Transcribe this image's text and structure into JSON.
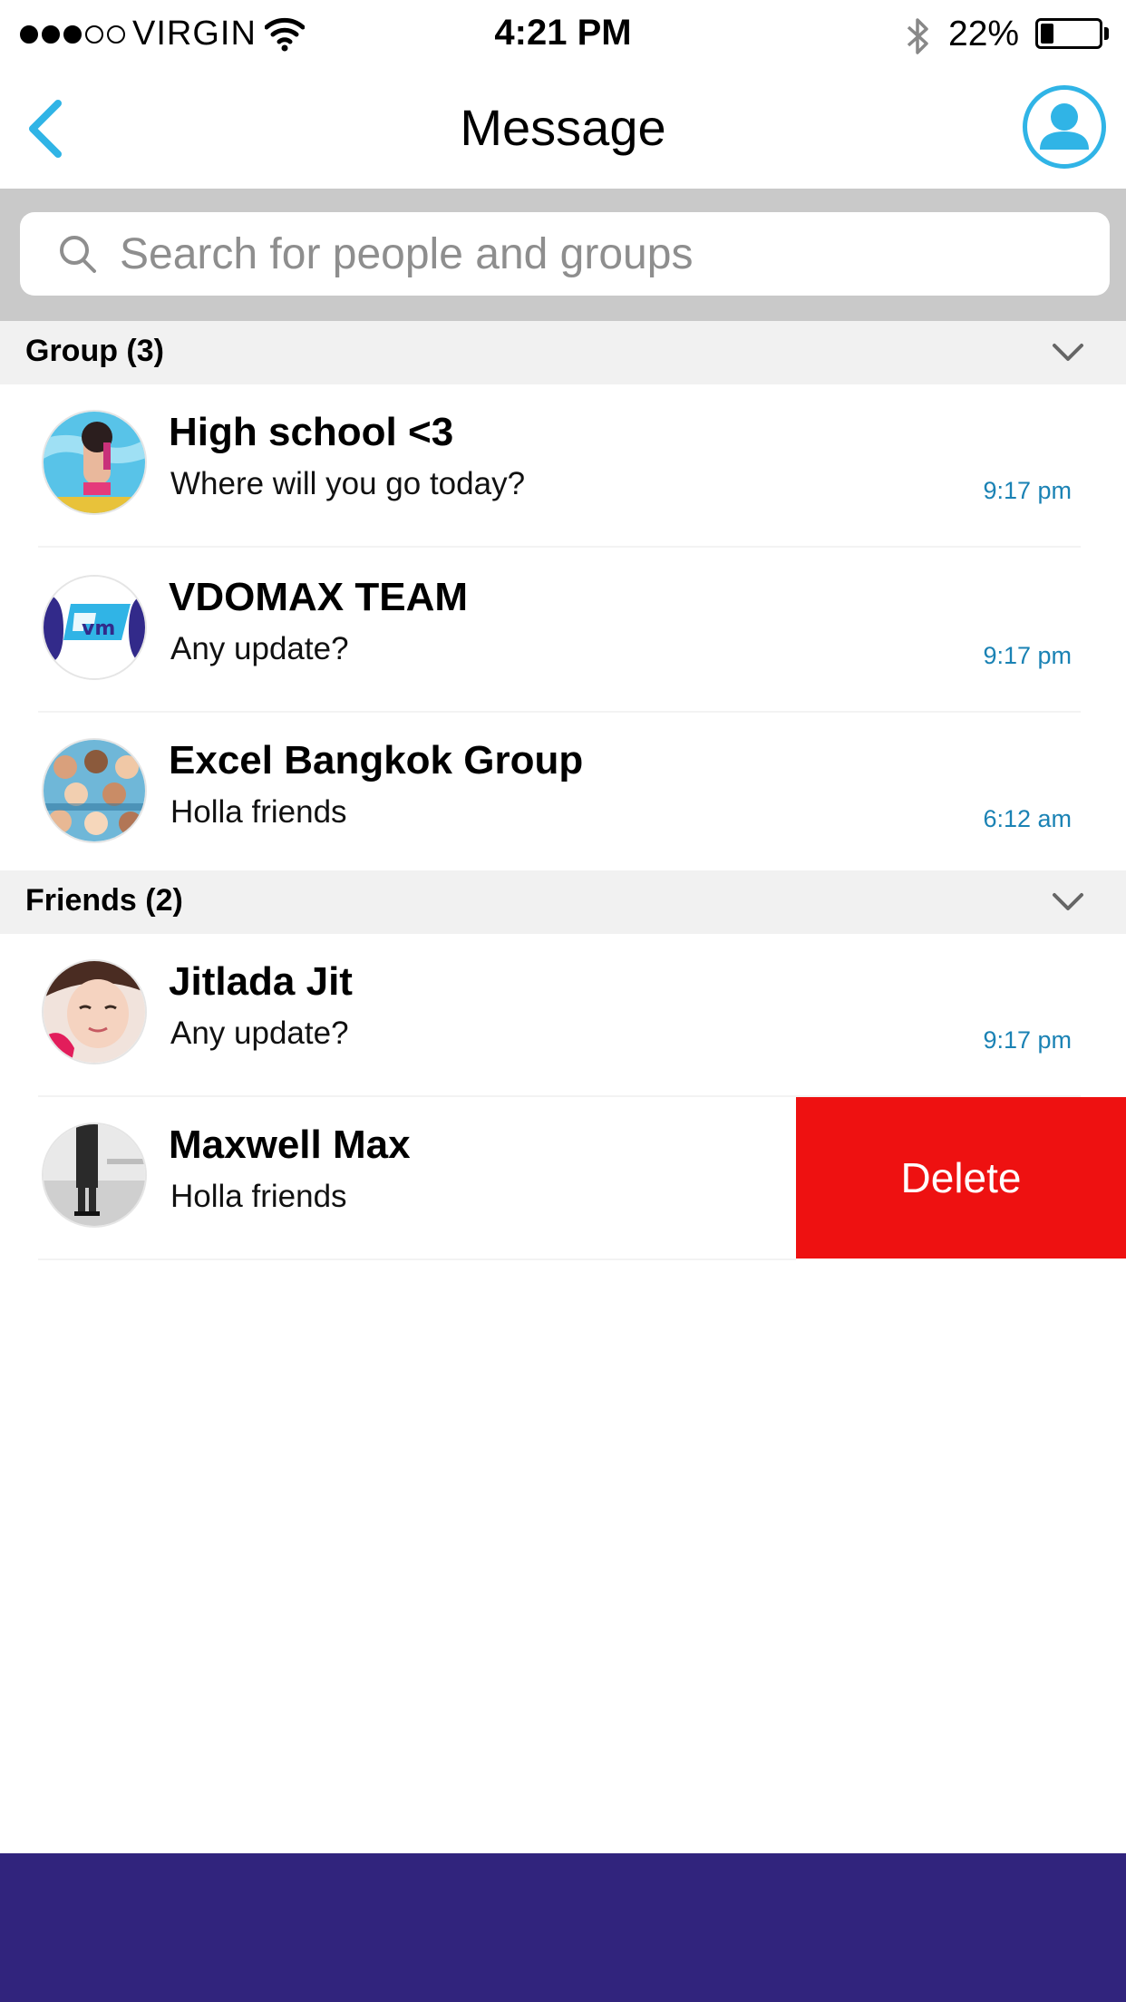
{
  "status_bar": {
    "carrier": "VIRGIN",
    "time": "4:21 PM",
    "battery": "22%",
    "battery_level": 0.22,
    "signal_bars": 3,
    "signal_total": 5
  },
  "nav": {
    "title": "Message",
    "back_icon": "chevron-left-icon",
    "profile_icon": "user-icon",
    "accent_color": "#30b4e6"
  },
  "search": {
    "placeholder": "Search for people and groups",
    "value": ""
  },
  "sections": [
    {
      "title": "Group (3)",
      "items": [
        {
          "name": "High school <3",
          "message": "Where will you go today?",
          "time": "9:17 pm"
        },
        {
          "name": "VDOMAX TEAM",
          "message": "Any update?",
          "time": "9:17 pm"
        },
        {
          "name": "Excel Bangkok Group",
          "message": "Holla friends",
          "time": "6:12 am"
        }
      ]
    },
    {
      "title": "Friends (2)",
      "items": [
        {
          "name": "Jitlada Jit",
          "message": "Any update?",
          "time": "9:17 pm"
        },
        {
          "name": "Maxwell Max",
          "message": "Holla friends",
          "time": "",
          "swipe_action": "Delete"
        }
      ]
    }
  ],
  "colors": {
    "delete": "#ee1111",
    "time": "#1a82b4",
    "bottom_bar": "#31247d",
    "search_background": "#c9c9c9"
  }
}
